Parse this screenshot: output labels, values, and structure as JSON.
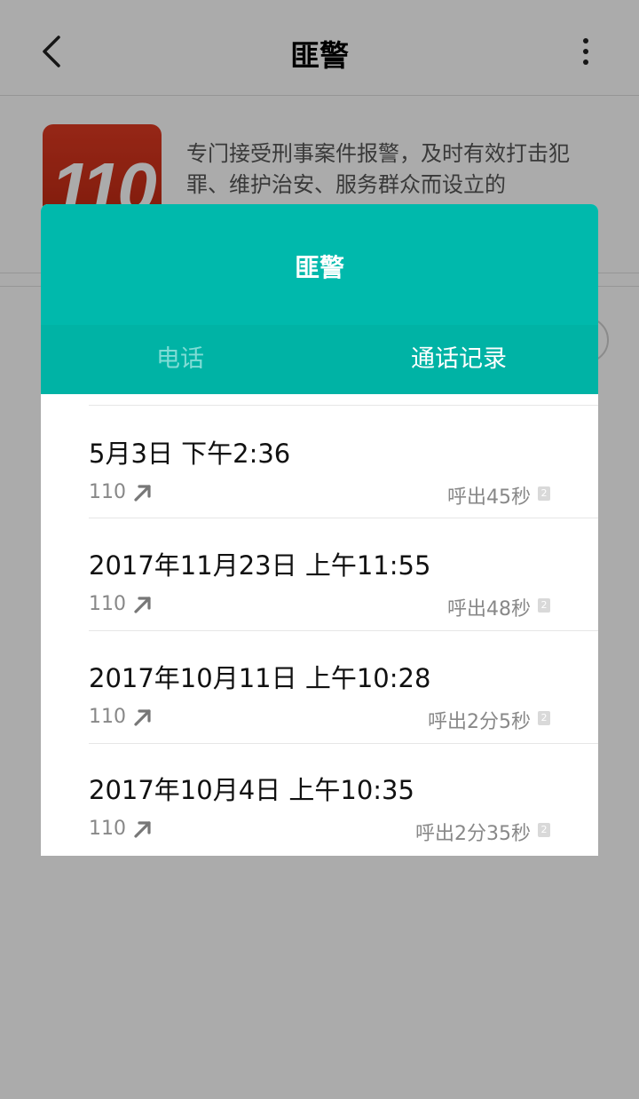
{
  "page": {
    "title": "匪警",
    "description": "专门接受刑事案件报警，及时有效打击犯罪、维护治安、服务群众而设立的",
    "logo_text": "110"
  },
  "dialog": {
    "title": "匪警",
    "tabs": [
      {
        "label": "电话",
        "active": false
      },
      {
        "label": "通话记录",
        "active": true
      }
    ],
    "records": [
      {
        "date": "5月3日 下午2:36",
        "number": "110",
        "duration": "呼出45秒",
        "sim": "2"
      },
      {
        "date": "2017年11月23日 上午11:55",
        "number": "110",
        "duration": "呼出48秒",
        "sim": "2"
      },
      {
        "date": "2017年10月11日 上午10:28",
        "number": "110",
        "duration": "呼出2分5秒",
        "sim": "2"
      },
      {
        "date": "2017年10月4日 上午10:35",
        "number": "110",
        "duration": "呼出2分35秒",
        "sim": "2"
      }
    ]
  },
  "colors": {
    "accent": "#00b9ac",
    "tab_bar": "#00b3a5",
    "logo_red": "#d2321b"
  }
}
